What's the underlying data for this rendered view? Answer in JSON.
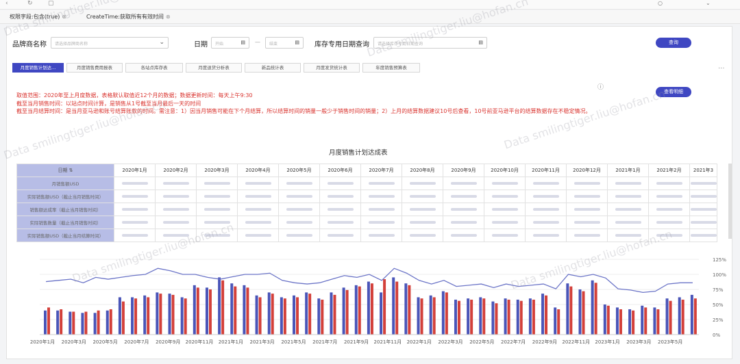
{
  "filters": [
    {
      "label": "权限字段:包含(true)",
      "close": "⊗"
    },
    {
      "label": "CreateTime:获取所有有效时间",
      "close": "⊗"
    }
  ],
  "form": {
    "brand_label": "品牌商名称",
    "brand_placeholder": "请选择品牌商名称",
    "date_label": "日期",
    "date_start": "开始",
    "date_sep": "—",
    "date_end": "结束",
    "inv_label": "库存专用日期查询",
    "inv_placeholder": "请选择库存专用日期查询",
    "query_button": "查询"
  },
  "tabs": [
    "月度销售计划达...",
    "月度销售费用报表",
    "各站点库存表",
    "月度退货分析表",
    "新品统计表",
    "月度发货统计表",
    "年度销售预算表"
  ],
  "notes": [
    "取值范围：2020年至上月度数据，表格默认取值近12个月的数据；数据更新时间：每天上午9:30",
    "截至当月销售时间：以站点时间计算，是销售从1号截至当月最后一天的时间",
    "截至当月结算时间：是当月亚马逊和账号结算账款的时间。需注意：1）因当月销售可能在下个月结算，所以结算时间的销量一般少于销售时间的销量；2）上月的结算数据建议10号后查看，10号前亚马逊平台的结算数据存在不稳定情况。"
  ],
  "detail_button": "查看明细",
  "table": {
    "title": "月度销售计划达成表",
    "corner": "日期 ⇅",
    "months": [
      "2020年1月",
      "2020年2月",
      "2020年3月",
      "2020年4月",
      "2020年5月",
      "2020年6月",
      "2020年7月",
      "2020年8月",
      "2020年9月",
      "2020年10月",
      "2020年11月",
      "2020年12月",
      "2021年1月",
      "2021年2月",
      "2021年3"
    ],
    "rows": [
      "月销售额USD",
      "实际销售额USD（截止当月销售时间）",
      "销售额达成率（截止当月销售时间）",
      "实际销售数量（截止当月销售时间）",
      "实际销售额USD（截止当月结算时间）"
    ]
  },
  "chart_data": {
    "type": "bar",
    "x_labels": [
      "2020年1月",
      "2020年3月",
      "2020年5月",
      "2020年7月",
      "2020年9月",
      "2020年11月",
      "2021年1月",
      "2021年3月",
      "2021年5月",
      "2021年7月",
      "2021年9月",
      "2021年11月",
      "2022年1月",
      "2022年3月",
      "2022年5月",
      "2022年7月",
      "2022年9月",
      "2022年11月",
      "2023年1月",
      "2023年3月",
      "2023年5月"
    ],
    "right_axis_ticks": [
      "125%",
      "100%",
      "75%",
      "50%",
      "25%",
      "0%"
    ],
    "ylim_right": [
      0,
      125
    ],
    "series": [
      {
        "color": "#4a55b8",
        "values": [
          40,
          40,
          38,
          36,
          36,
          40,
          62,
          62,
          65,
          70,
          68,
          62,
          82,
          78,
          95,
          85,
          82,
          65,
          70,
          62,
          65,
          70,
          60,
          70,
          78,
          82,
          88,
          70,
          95,
          85,
          62,
          65,
          72,
          58,
          60,
          62,
          55,
          60,
          58,
          60,
          68,
          45,
          85,
          75,
          90,
          50,
          45,
          42,
          48,
          45,
          60,
          62,
          66
        ]
      },
      {
        "color": "#d3403a",
        "values": [
          45,
          42,
          38,
          38,
          40,
          42,
          55,
          60,
          62,
          68,
          66,
          60,
          78,
          75,
          90,
          80,
          78,
          62,
          68,
          60,
          62,
          68,
          58,
          66,
          74,
          80,
          85,
          92,
          88,
          82,
          60,
          62,
          70,
          56,
          58,
          60,
          52,
          58,
          56,
          58,
          65,
          42,
          80,
          72,
          86,
          48,
          42,
          40,
          45,
          42,
          56,
          58,
          60
        ]
      },
      {
        "color": "#6b74c7",
        "values": [
          88,
          90,
          92,
          86,
          95,
          92,
          95,
          98,
          100,
          110,
          106,
          100,
          100,
          95,
          92,
          96,
          100,
          100,
          102,
          90,
          86,
          84,
          86,
          92,
          98,
          95,
          100,
          90,
          110,
          102,
          90,
          84,
          90,
          80,
          82,
          84,
          78,
          84,
          80,
          82,
          84,
          76,
          100,
          96,
          100,
          94,
          76,
          74,
          70,
          72,
          84,
          86,
          86
        ]
      }
    ]
  }
}
